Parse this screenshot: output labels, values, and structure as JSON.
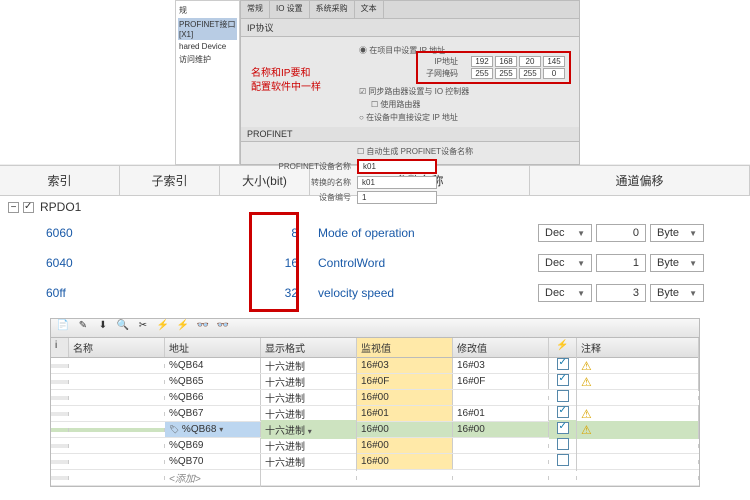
{
  "topTree": {
    "items": [
      "规",
      "PROFINET接口 [X1]",
      "hared Device",
      "访问维护"
    ]
  },
  "config": {
    "tabs": [
      "常规",
      "IO 设置",
      "系统采购",
      "文本"
    ],
    "ipSection": "IP协议",
    "redNote1": "名称和IP要和",
    "redNote2": "配置软件中一样",
    "setIpInProject": "在项目中设置 IP 地址",
    "ipLabel": "IP地址",
    "ipParts": [
      "192",
      "168",
      "20",
      "145"
    ],
    "maskLabel": "子网掩码",
    "maskParts": [
      "255",
      "255",
      "255",
      "0"
    ],
    "syncRouter": "同步路由器设置与 IO 控制器",
    "useRouter": "使用路由器",
    "setIpInDevice": "在设备中直接设定 IP 地址",
    "profinetSection": "PROFINET",
    "autoGen": "自动生成 PROFINET设备名称",
    "devNameLabel": "PROFINET设备名称",
    "devName": "k01",
    "convNameLabel": "转换的名称",
    "convName": "k01",
    "devNumLabel": "设备编号",
    "devNum": "1"
  },
  "mid": {
    "headers": {
      "idx": "索引",
      "sub": "子索引",
      "size": "大小(bit)",
      "param": "参数名称",
      "chan": "通道偏移"
    },
    "group": "RPDO1",
    "rows": [
      {
        "idx": "6060",
        "size": "8",
        "param": "Mode of operation",
        "dec": "Dec",
        "val": "0",
        "unit": "Byte"
      },
      {
        "idx": "6040",
        "size": "16",
        "param": "ControlWord",
        "dec": "Dec",
        "val": "1",
        "unit": "Byte"
      },
      {
        "idx": "60ff",
        "size": "32",
        "param": "velocity speed",
        "dec": "Dec",
        "val": "3",
        "unit": "Byte"
      }
    ]
  },
  "watch": {
    "headers": {
      "name": "名称",
      "addr": "地址",
      "fmt": "显示格式",
      "mon": "监视值",
      "mod": "修改值",
      "note": "注释"
    },
    "rows": [
      {
        "addr": "%QB64",
        "fmt": "十六进制",
        "mon": "16#03",
        "mod": "16#03",
        "chk": true,
        "warn": true
      },
      {
        "addr": "%QB65",
        "fmt": "十六进制",
        "mon": "16#0F",
        "mod": "16#0F",
        "chk": true,
        "warn": true
      },
      {
        "addr": "%QB66",
        "fmt": "十六进制",
        "mon": "16#00",
        "mod": "",
        "chk": false,
        "warn": false
      },
      {
        "addr": "%QB67",
        "fmt": "十六进制",
        "mon": "16#01",
        "mod": "16#01",
        "chk": true,
        "warn": true
      },
      {
        "addr": "%QB68",
        "fmt": "十六进制",
        "mon": "16#00",
        "mod": "16#00",
        "chk": true,
        "warn": true,
        "selected": true
      },
      {
        "addr": "%QB69",
        "fmt": "十六进制",
        "mon": "16#00",
        "mod": "",
        "chk": false,
        "warn": false
      },
      {
        "addr": "%QB70",
        "fmt": "十六进制",
        "mon": "16#00",
        "mod": "",
        "chk": false,
        "warn": false
      }
    ],
    "addNew": "<添加>"
  }
}
